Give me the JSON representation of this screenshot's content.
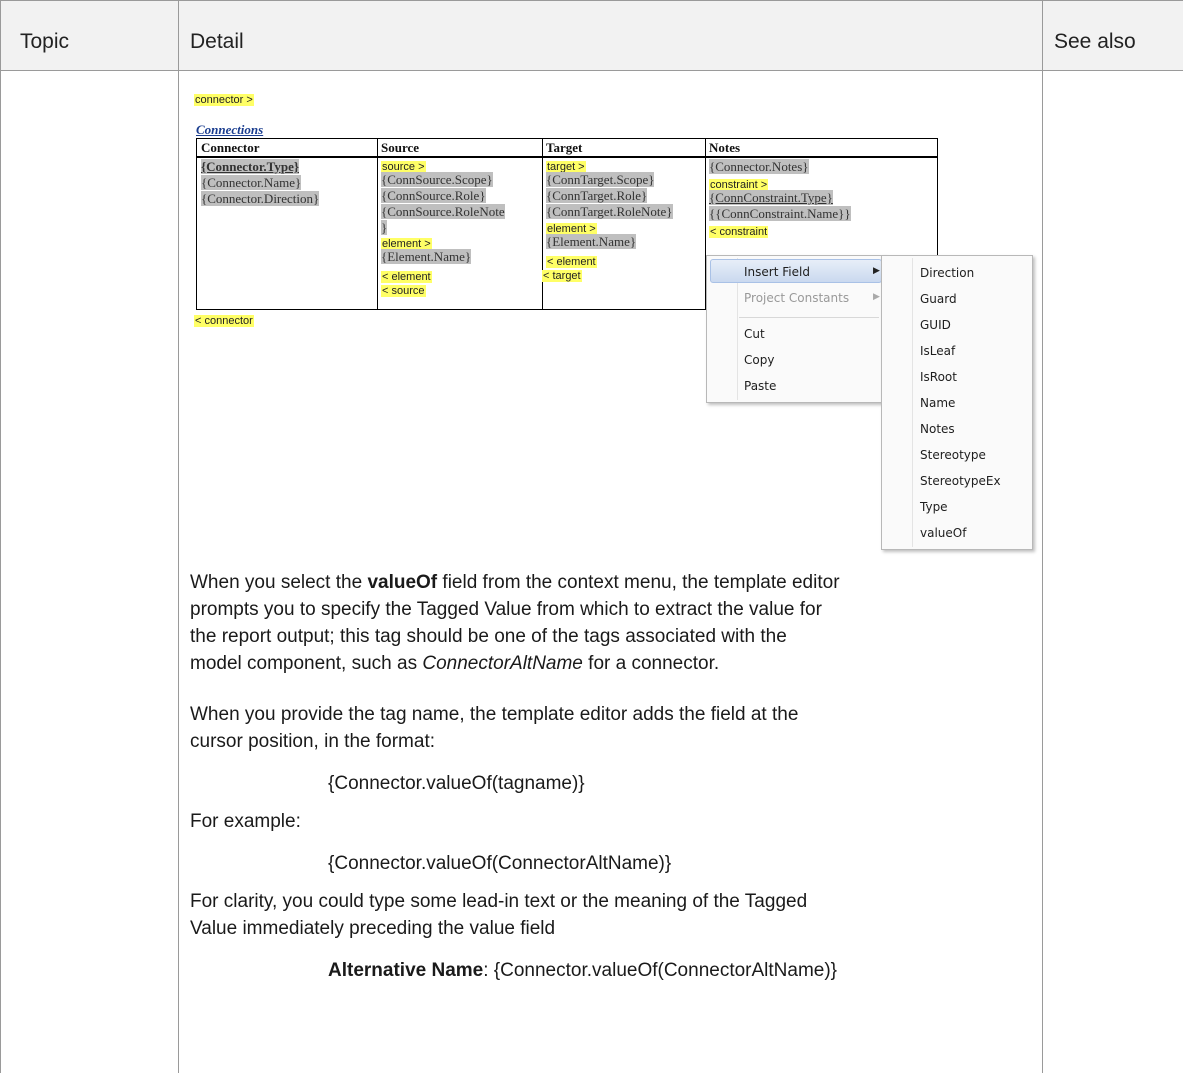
{
  "header": {
    "col1": "Topic",
    "col2": "Detail",
    "col3": "See also"
  },
  "template": {
    "connector_open": "connector >",
    "connections_title": "Connections",
    "columns": [
      "Connector",
      "Source",
      "Target",
      "Notes"
    ],
    "connector_col": [
      "{Connector.Type}",
      "{Connector.Name}",
      "{Connector.Direction}"
    ],
    "source_col": {
      "source_open": "source >",
      "fields": [
        "{ConnSource.Scope}",
        "{ConnSource.Role}",
        "{ConnSource.RoleNote",
        "}"
      ],
      "element_open": "element >",
      "element_field": "{Element.Name}",
      "element_close": "< element",
      "source_close": "< source"
    },
    "target_col": {
      "target_open": "target >",
      "fields": [
        "{ConnTarget.Scope}",
        "{ConnTarget.Role}",
        "{ConnTarget.RoleNote}"
      ],
      "element_open": "element >",
      "element_field": "{Element.Name}",
      "element_close": "< element",
      "target_close": "< target"
    },
    "notes_col": {
      "field": "{Connector.Notes}",
      "constraint_open": "constraint >",
      "constraint_type": "{ConnConstraint.Type}",
      "constraint_name": "{{ConnConstraint.Name}}",
      "constraint_close": "< constraint"
    },
    "connector_close": "< connector"
  },
  "context_menu": {
    "items": [
      "Insert Field",
      "Project Constants",
      "Cut",
      "Copy",
      "Paste"
    ]
  },
  "submenu": {
    "items": [
      "Direction",
      "Guard",
      "GUID",
      "IsLeaf",
      "IsRoot",
      "Name",
      "Notes",
      "Stereotype",
      "StereotypeEx",
      "Type",
      "valueOf"
    ]
  },
  "body": {
    "p1_a": "When you select the ",
    "p1_bold": "valueOf",
    "p1_b": " field from the context menu, the template editor",
    "p1_line2": "prompts you to specify the Tagged Value from which to extract the value for",
    "p1_line3": "the report output; this tag should be one of the tags associated with the",
    "p1_line4_a": "model component, such as ",
    "p1_line4_it": "ConnectorAltName",
    "p1_line4_b": " for a connector.",
    "p2_line1": "When you provide the tag name, the template editor adds the field at the",
    "p2_line2": "cursor position, in the format:",
    "code1": "{Connector.valueOf(tagname)}",
    "p3": "For example:",
    "code2": "{Connector.valueOf(ConnectorAltName)}",
    "p4_line1": "For clarity, you could type some lead-in text or the meaning of the Tagged",
    "p4_line2": "Value immediately preceding the value field",
    "code3_bold": "Alternative Name",
    "code3_rest": ": {Connector.valueOf(ConnectorAltName)}"
  }
}
